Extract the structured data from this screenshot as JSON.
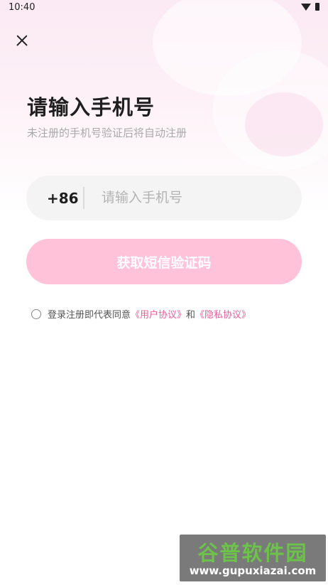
{
  "status_bar": {
    "time": "10:40"
  },
  "login": {
    "title": "请输入手机号",
    "subtitle": "未注册的手机号验证后将自动注册",
    "country_code": "+86",
    "phone_placeholder": "请输入手机号",
    "phone_value": "",
    "submit_label": "获取短信验证码"
  },
  "agreement": {
    "prefix": "登录注册即代表同意",
    "user_agreement": "《用户协议》",
    "connector": "和",
    "privacy_policy": "《隐私协议》"
  },
  "watermark": {
    "title": "谷普软件园",
    "url": "www.gupuxiazai.com"
  },
  "colors": {
    "accent_pink": "#e8609a",
    "button_pink": "#ffc2d9",
    "background_tint": "#fbe9f3"
  }
}
